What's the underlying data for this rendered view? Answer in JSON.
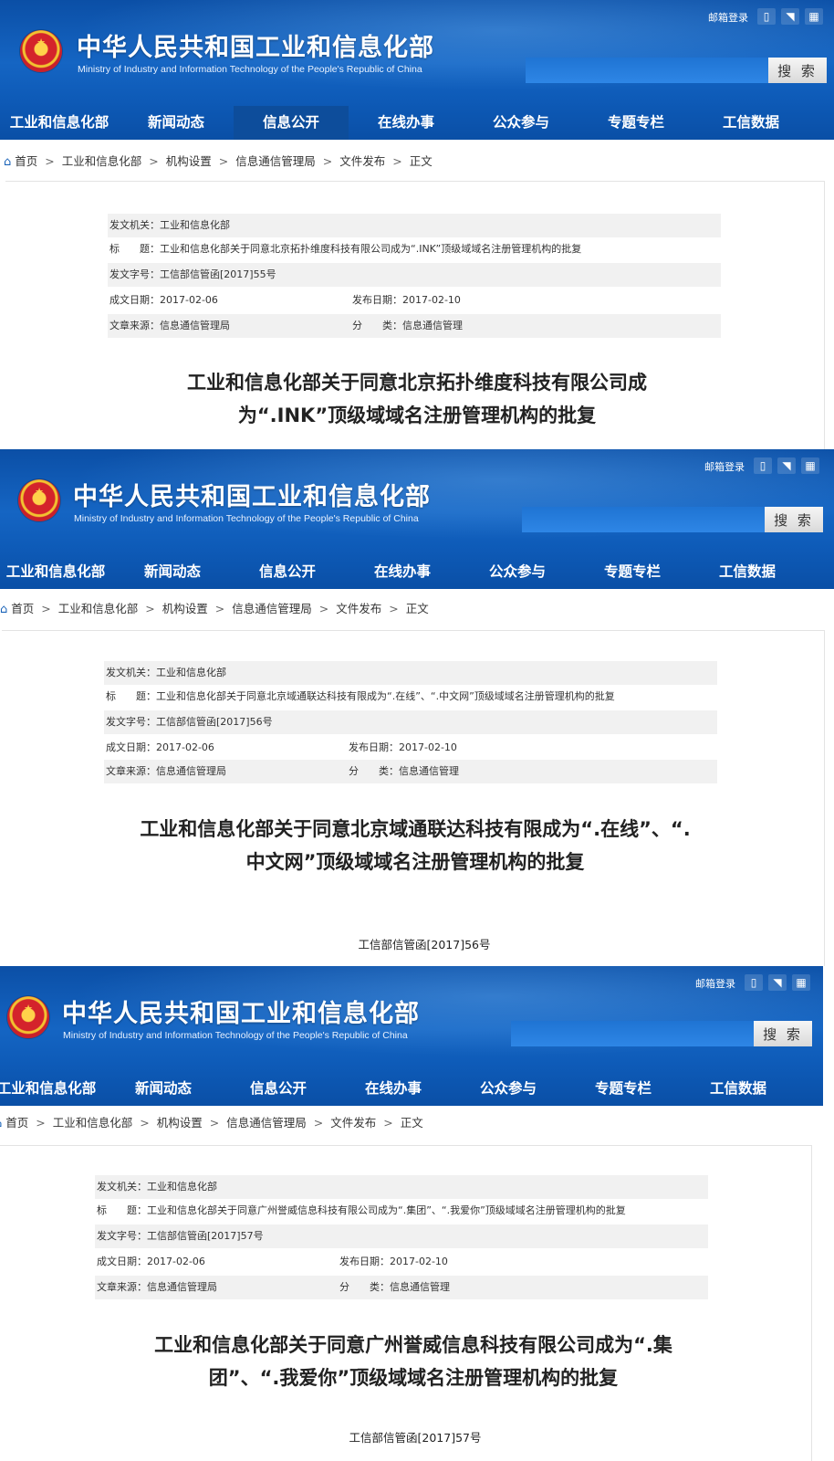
{
  "header": {
    "site_title": "中华人民共和国工业和信息化部",
    "site_subtitle": "Ministry of Industry and Information Technology of the People's Republic of China",
    "mail_login": "邮箱登录",
    "search_button": "搜 索",
    "search_placeholder": "",
    "icons": [
      "mobile-icon",
      "rss-icon",
      "grid-icon"
    ]
  },
  "nav": [
    "工业和信息化部",
    "新闻动态",
    "信息公开",
    "在线办事",
    "公众参与",
    "专题专栏",
    "工信数据"
  ],
  "breadcrumb": [
    "首页",
    "工业和信息化部",
    "机构设置",
    "信息通信管理局",
    "文件发布",
    "正文"
  ],
  "meta_labels": {
    "issuer": "发文机关：",
    "title": "标　　题：",
    "doc_no": "发文字号：",
    "created": "成文日期：",
    "published": "发布日期：",
    "source": "文章来源：",
    "category": "分　　类："
  },
  "articles": [
    {
      "issuer": "工业和信息化部",
      "title": "工业和信息化部关于同意北京拓扑维度科技有限公司成为“.INK”顶级域域名注册管理机构的批复",
      "doc_no": "工信部信管函[2017]55号",
      "created": "2017-02-06",
      "published": "2017-02-10",
      "source": "信息通信管理局",
      "category": "信息通信管理",
      "heading_line1": "工业和信息化部关于同意北京拓扑维度科技有限公司成",
      "heading_line2": "为“.INK”顶级域域名注册管理机构的批复",
      "doc_number_display": ""
    },
    {
      "issuer": "工业和信息化部",
      "title": "工业和信息化部关于同意北京域通联达科技有限成为“.在线”、“.中文网”顶级域域名注册管理机构的批复",
      "doc_no": "工信部信管函[2017]56号",
      "created": "2017-02-06",
      "published": "2017-02-10",
      "source": "信息通信管理局",
      "category": "信息通信管理",
      "heading_line1": "工业和信息化部关于同意北京域通联达科技有限成为“.在线”、“.",
      "heading_line2": "中文网”顶级域域名注册管理机构的批复",
      "doc_number_display": "工信部信管函[2017]56号"
    },
    {
      "issuer": "工业和信息化部",
      "title": "工业和信息化部关于同意广州誉威信息科技有限公司成为“.集团”、“.我爱你”顶级域域名注册管理机构的批复",
      "doc_no": "工信部信管函[2017]57号",
      "created": "2017-02-06",
      "published": "2017-02-10",
      "source": "信息通信管理局",
      "category": "信息通信管理",
      "heading_line1": "工业和信息化部关于同意广州誉威信息科技有限公司成为“.集",
      "heading_line2": "团”、“.我爱你”顶级域域名注册管理机构的批复",
      "doc_number_display": "工信部信管函[2017]57号"
    }
  ],
  "colors": {
    "header_blue": "#1565c3",
    "nav_active": "#0d4d9b",
    "shade_row": "#f1f1f1",
    "link_blue": "#1a63b8"
  }
}
